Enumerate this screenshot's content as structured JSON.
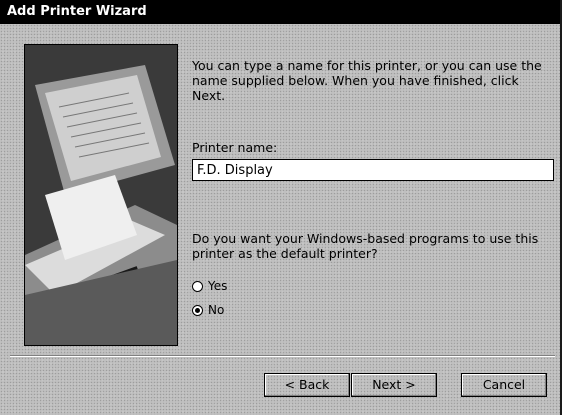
{
  "window": {
    "title": "Add Printer Wizard"
  },
  "content": {
    "instructions": "You can type a name for this printer, or you can use the name supplied below. When you have finished, click Next.",
    "printer_name_label": "Printer name:",
    "printer_name_value": "F.D. Display",
    "default_question": "Do you want your Windows-based programs to use this printer as the default printer?",
    "options": {
      "yes_label": "Yes",
      "no_label": "No",
      "selected": "No"
    }
  },
  "buttons": {
    "back_label": "< Back",
    "next_label": "Next >",
    "cancel_label": "Cancel"
  }
}
